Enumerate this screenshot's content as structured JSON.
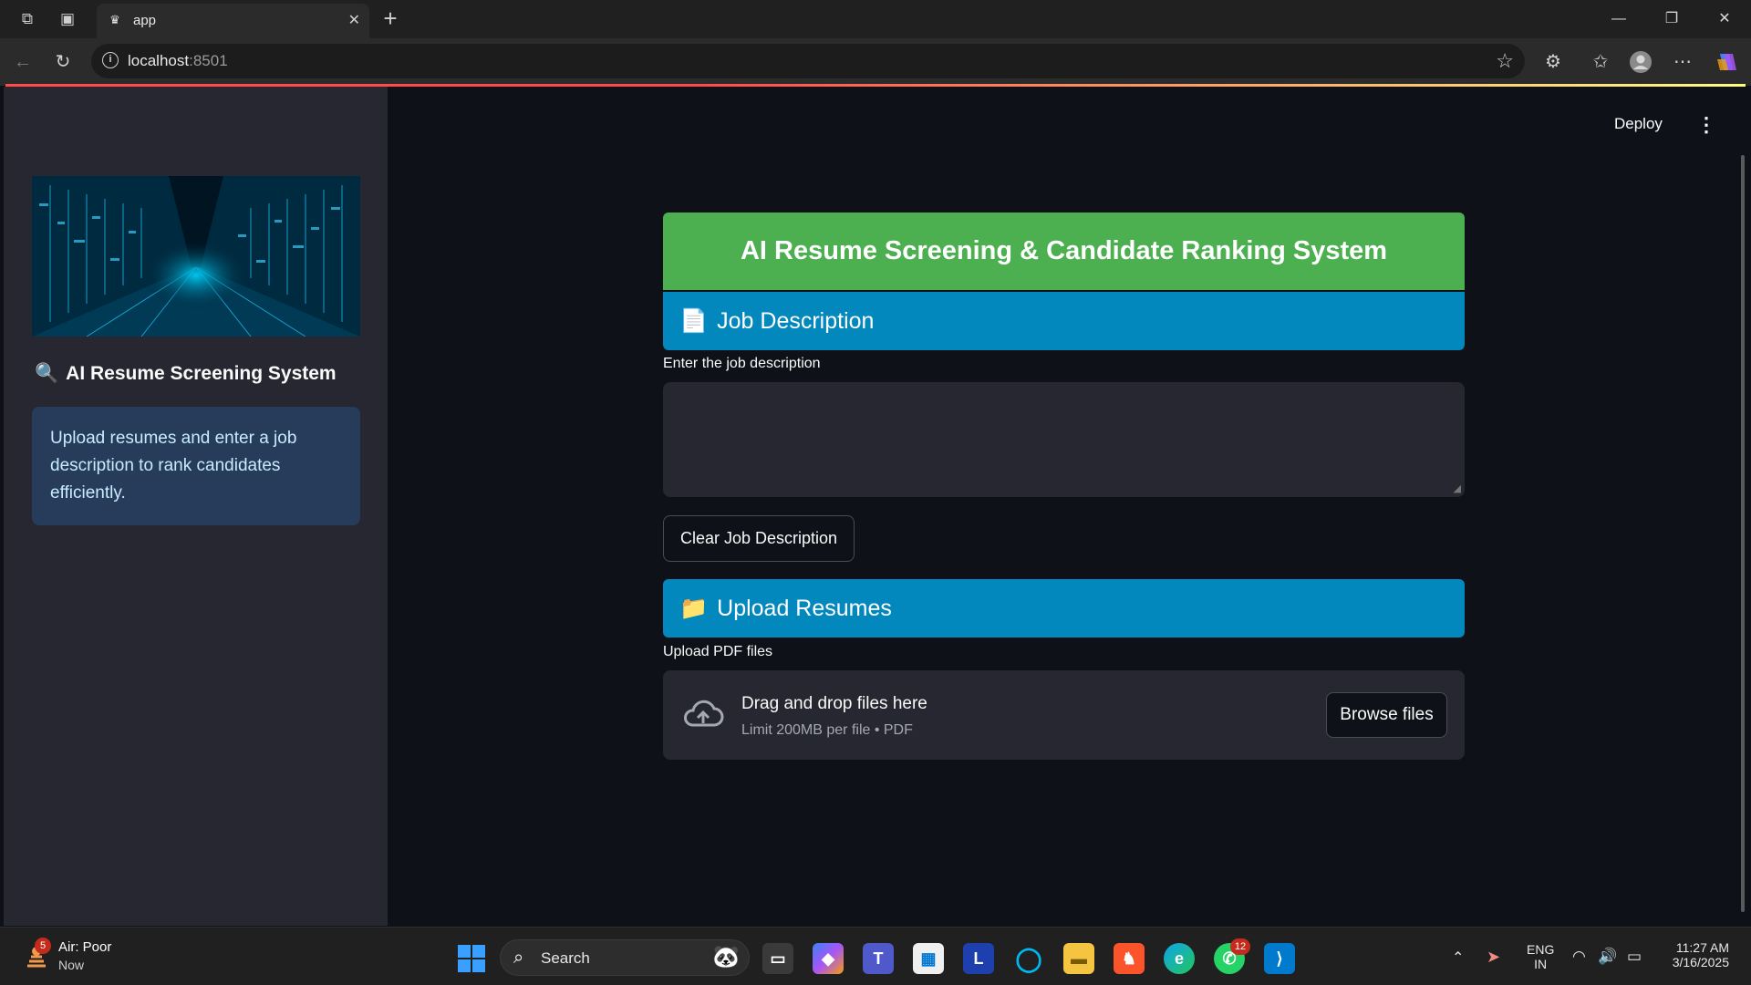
{
  "browser": {
    "tab_title": "app",
    "url_host": "localhost",
    "url_port": ":8501"
  },
  "app": {
    "deploy_label": "Deploy",
    "menu_icon": "kebab-menu-icon"
  },
  "sidebar": {
    "title_icon": "🔍",
    "title": "AI Resume Screening System",
    "info_text": "Upload resumes and enter a job description to rank candidates efficiently."
  },
  "main": {
    "banner_title": "AI Resume Screening & Candidate Ranking System",
    "job_section": {
      "icon": "📄",
      "title": "Job Description",
      "input_label": "Enter the job description",
      "input_value": "",
      "clear_button": "Clear Job Description"
    },
    "upload_section": {
      "icon": "📁",
      "title": "Upload Resumes",
      "input_label": "Upload PDF files",
      "drop_title": "Drag and drop files here",
      "drop_hint": "Limit 200MB per file • PDF",
      "browse_button": "Browse files"
    }
  },
  "taskbar": {
    "weather_badge": "5",
    "weather_status": "Air: Poor",
    "weather_time": "Now",
    "search_label": "Search",
    "whatsapp_badge": "12",
    "lang_line1": "ENG",
    "lang_line2": "IN",
    "clock_time": "11:27 AM",
    "clock_date": "3/16/2025"
  },
  "colors": {
    "banner": "#4caf50",
    "section_header": "#0288bd",
    "sidebar_bg": "#262730",
    "main_bg": "#0e1117",
    "info_bg": "#273c5a",
    "info_text": "#c7ebff"
  }
}
